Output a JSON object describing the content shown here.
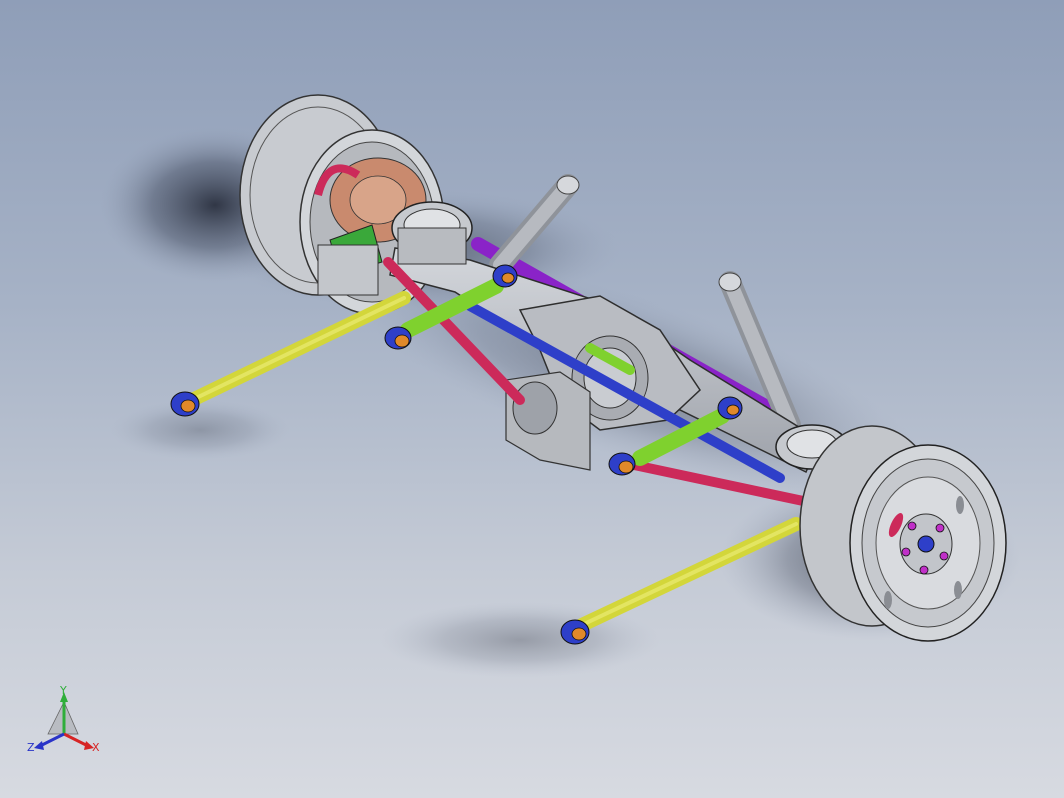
{
  "triad": {
    "x_label": "X",
    "y_label": "Y",
    "z_label": "Z",
    "x_color": "#d62424",
    "y_color": "#2fae3a",
    "z_color": "#2a34c8"
  },
  "part_colors": {
    "housing": "#b9bcc2",
    "trailing_arm": "#d3d63a",
    "upper_link": "#7fd12e",
    "panhard_rod": "#cc2a5a",
    "diagonal_link_blue": "#2e3fc9",
    "diagonal_link_purple": "#8a23c8",
    "hub_bolts": "#c030c8",
    "bushing_orange": "#e0892a",
    "brake_rotor": "#c98a6e"
  }
}
